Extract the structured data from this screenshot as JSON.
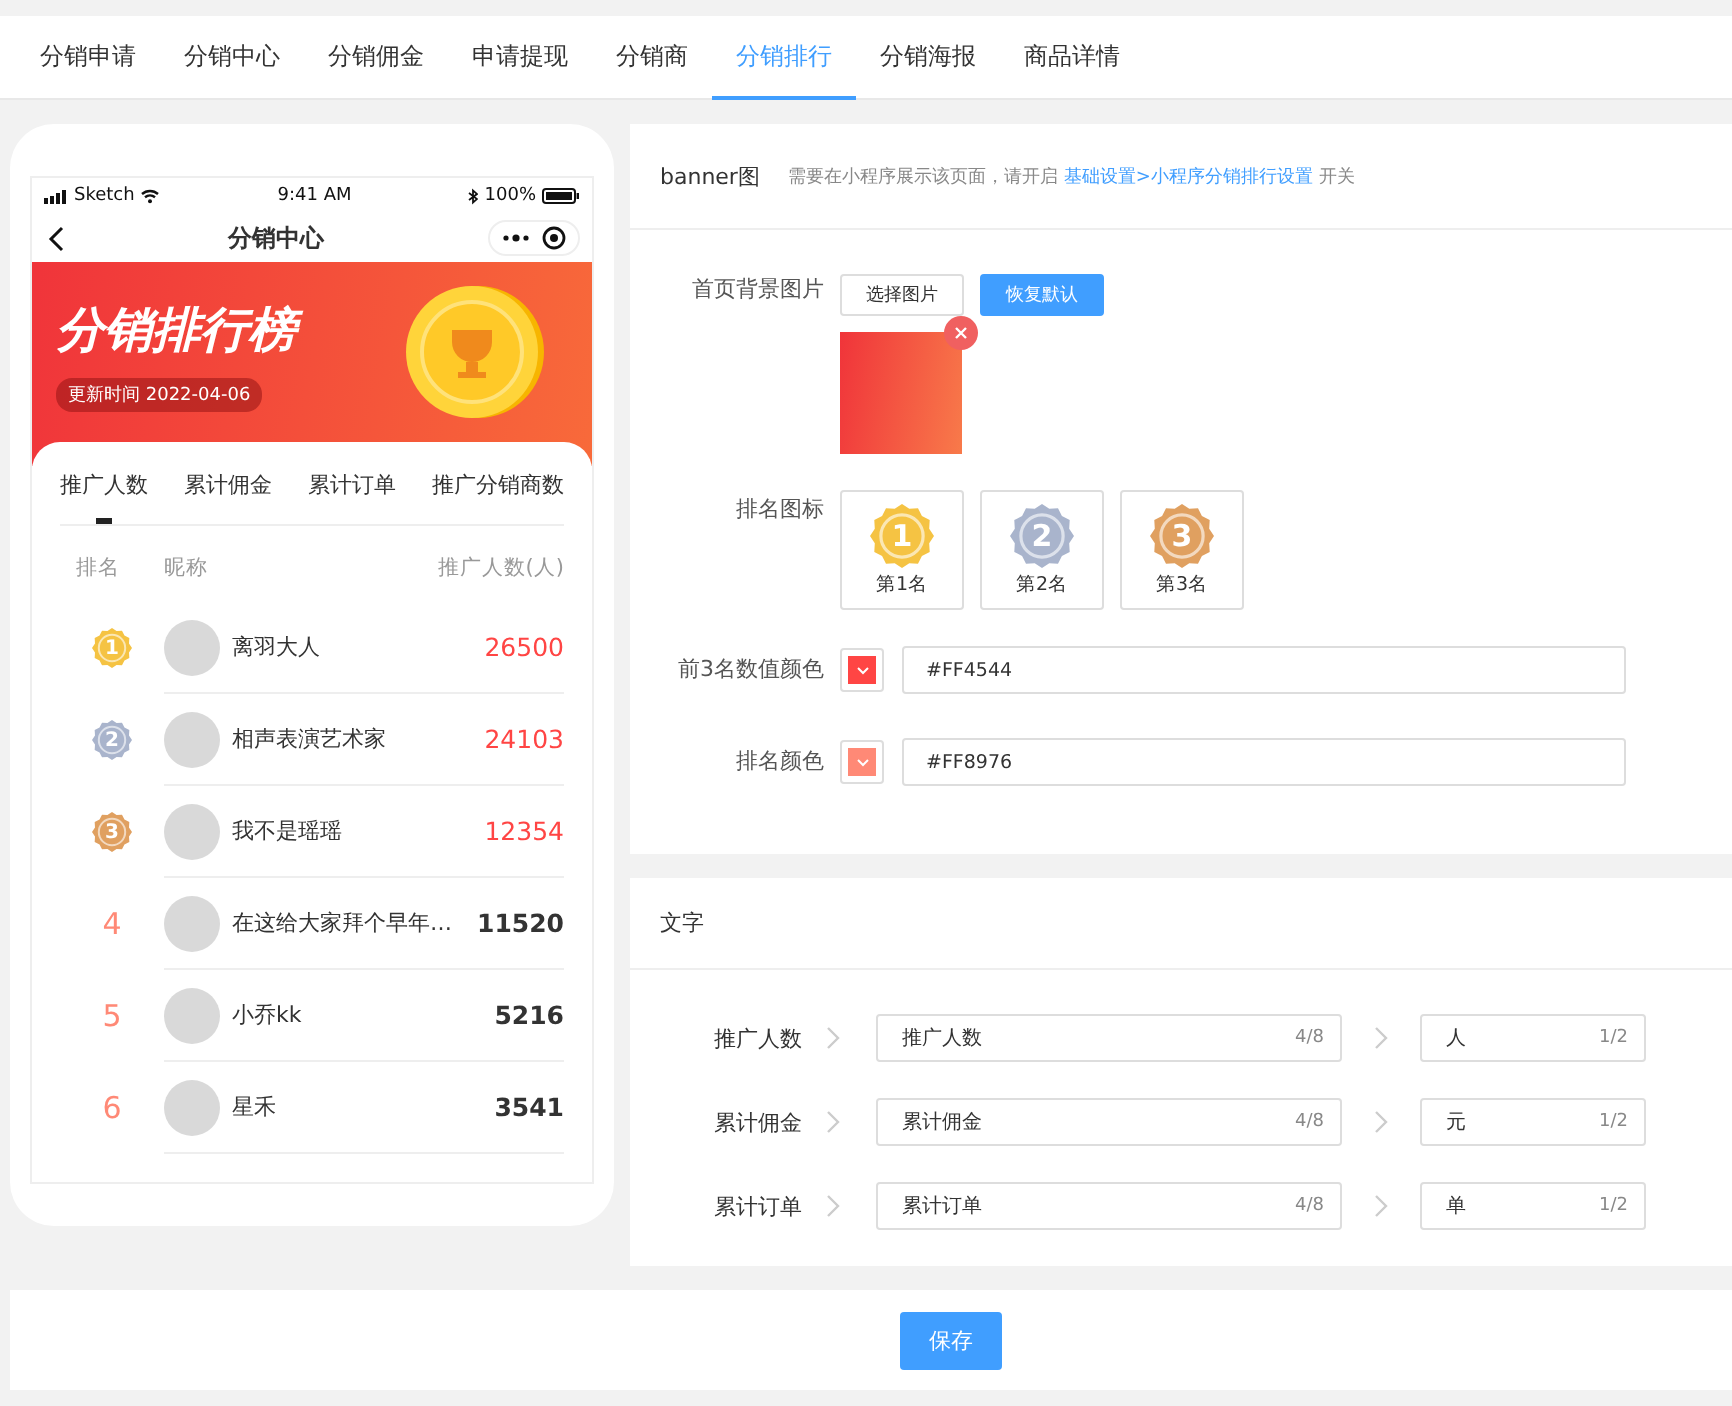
{
  "tabs": [
    {
      "label": "分销申请",
      "selected": false
    },
    {
      "label": "分销中心",
      "selected": false
    },
    {
      "label": "分销佣金",
      "selected": false
    },
    {
      "label": "申请提现",
      "selected": false
    },
    {
      "label": "分销商",
      "selected": false
    },
    {
      "label": "分销排行",
      "selected": true
    },
    {
      "label": "分销海报",
      "selected": false
    },
    {
      "label": "商品详情",
      "selected": false
    }
  ],
  "phone": {
    "status": {
      "carrier": "Sketch",
      "time": "9:41 AM",
      "battery": "100%"
    },
    "title": "分销中心",
    "banner": {
      "title": "分销排行榜",
      "update": "更新时间 2022-04-06"
    },
    "tabs": [
      {
        "label": "推广人数",
        "selected": true
      },
      {
        "label": "累计佣金",
        "selected": false
      },
      {
        "label": "累计订单",
        "selected": false
      },
      {
        "label": "推广分销商数",
        "selected": false
      }
    ],
    "columns": [
      "排名",
      "昵称",
      "推广人数(人)"
    ],
    "rows": [
      {
        "kind": "medal",
        "rank": "1",
        "color": "#f5c343",
        "name": "离羽大人",
        "value": "26500"
      },
      {
        "kind": "medal",
        "rank": "2",
        "color": "#a9b4cc",
        "name": "相声表演艺术家",
        "value": "24103"
      },
      {
        "kind": "medal",
        "rank": "3",
        "color": "#e0a060",
        "name": "我不是瑶瑶",
        "value": "12354"
      },
      {
        "kind": "number",
        "rank": "4",
        "name": "在这给大家拜个早年…",
        "value": "11520"
      },
      {
        "kind": "number",
        "rank": "5",
        "name": "小乔kk",
        "value": "5216"
      },
      {
        "kind": "number",
        "rank": "6",
        "name": "星禾",
        "value": "3541"
      }
    ]
  },
  "banner_section": {
    "title": "banner图",
    "hint": "需要在小程序展示该页面，请开启",
    "link": "基础设置>小程序分销排行设置",
    "hint_end": "开关",
    "background": {
      "label": "首页背景图片",
      "buttons": [
        {
          "label": "选择图片",
          "kind": "plain"
        },
        {
          "label": "恢复默认",
          "kind": "primary"
        }
      ]
    },
    "rank_icons": {
      "label": "排名图标",
      "items": [
        {
          "label": "第1名",
          "rank": "1",
          "color": "#f5c343"
        },
        {
          "label": "第2名",
          "rank": "2",
          "color": "#a9b4cc"
        },
        {
          "label": "第3名",
          "rank": "3",
          "color": "#e0a060"
        }
      ]
    },
    "top3_color": {
      "label": "前3名数值颜色",
      "value": "#FF4544"
    },
    "rank_color": {
      "label": "排名颜色",
      "value": "#FF8976"
    }
  },
  "text_section": {
    "title": "文字",
    "rows": [
      {
        "label": "推广人数",
        "value": "推广人数",
        "count": "4/8",
        "unit": "人",
        "unit_count": "1/2"
      },
      {
        "label": "累计佣金",
        "value": "累计佣金",
        "count": "4/8",
        "unit": "元",
        "unit_count": "1/2"
      },
      {
        "label": "累计订单",
        "value": "累计订单",
        "count": "4/8",
        "unit": "单",
        "unit_count": "1/2"
      }
    ]
  },
  "save": "保存"
}
